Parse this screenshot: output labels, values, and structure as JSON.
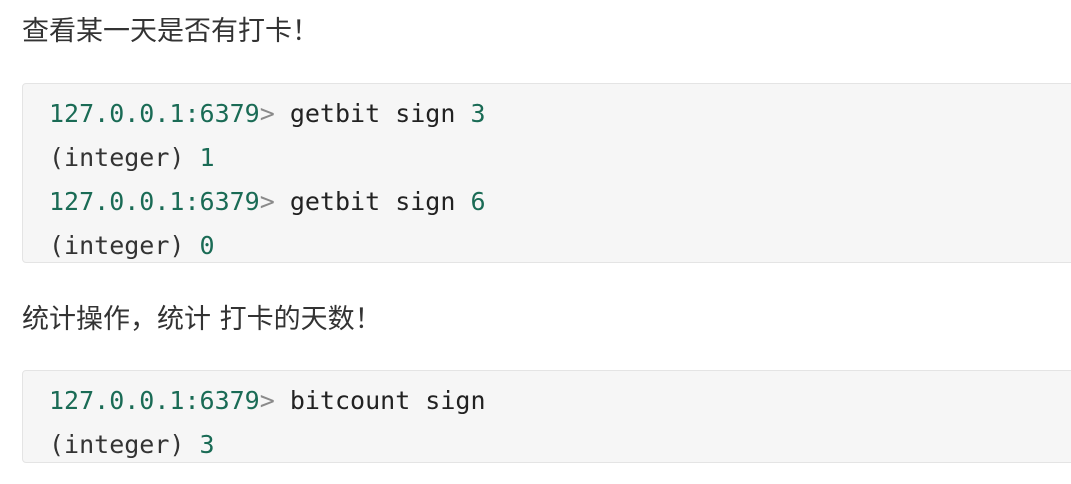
{
  "section1": {
    "title": "查看某一天是否有打卡！",
    "lines": [
      {
        "prompt": "127.0.0.1:6379",
        "arrow": ">",
        "command": " getbit sign ",
        "arg": "3"
      },
      {
        "prefix": "(integer)",
        "value": " 1"
      },
      {
        "prompt": "127.0.0.1:6379",
        "arrow": ">",
        "command": " getbit sign ",
        "arg": "6"
      },
      {
        "prefix": "(integer)",
        "value": " 0"
      }
    ]
  },
  "section2": {
    "title": "统计操作，统计 打卡的天数！",
    "lines": [
      {
        "prompt": "127.0.0.1:6379",
        "arrow": ">",
        "command": " bitcount sign"
      },
      {
        "prefix": "(integer)",
        "value": " 3"
      }
    ]
  },
  "colors": {
    "prompt": "#1a6b55",
    "code_background": "#f6f6f6",
    "text": "#333333"
  }
}
